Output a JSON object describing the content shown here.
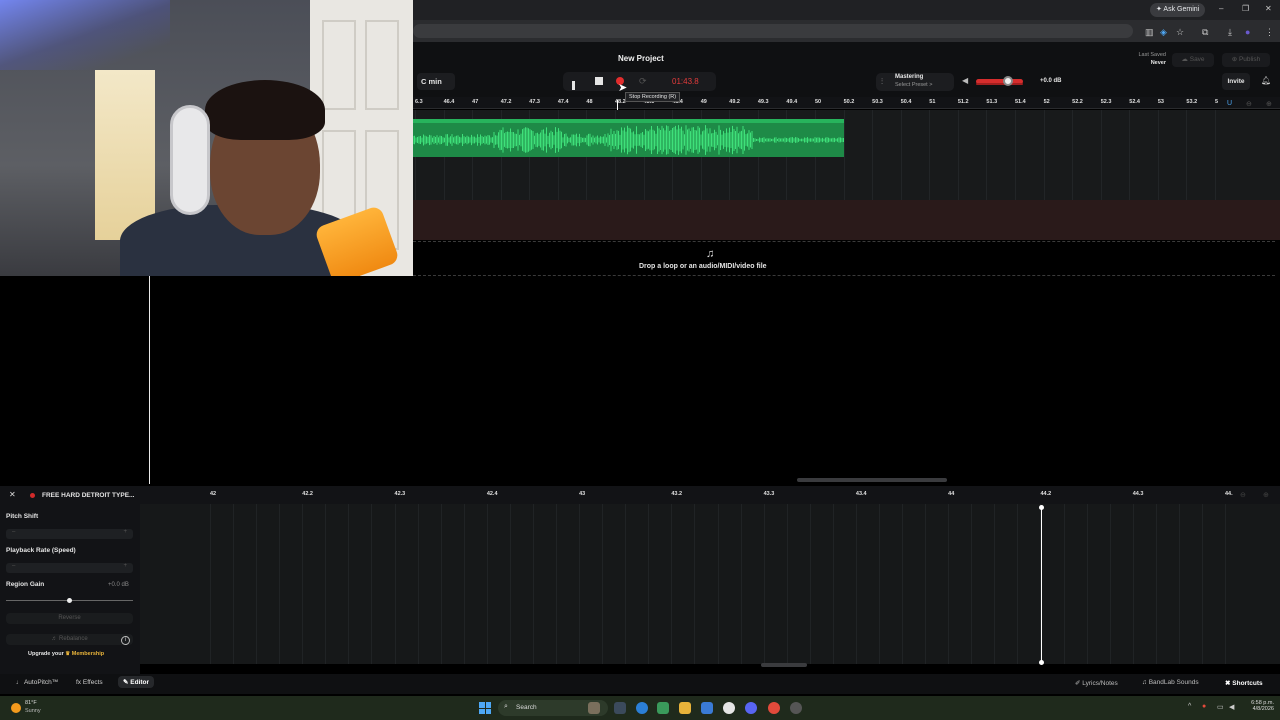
{
  "browser": {
    "ask_gemini": "✦ Ask Gemini",
    "window_controls": [
      "–",
      "❐",
      "✕"
    ]
  },
  "header": {
    "project_title": "New Project",
    "key": "C min",
    "time": "01:43.8",
    "tooltip": "Stop Recording (R)",
    "mastering_label": "Mastering",
    "mastering_preset": "Select Preset >",
    "volume_db": "+0.0 dB",
    "volume_level": 0.7,
    "last_saved_label": "Last Saved",
    "last_saved_value": "Never",
    "save_label": "Save",
    "publish_label": "Publish",
    "invite_label": "Invite"
  },
  "ruler_top": [
    "6.3",
    "46.4",
    "47",
    "47.2",
    "47.3",
    "47.4",
    "48",
    "48.2",
    "48.3",
    "48.4",
    "49",
    "49.2",
    "49.3",
    "49.4",
    "50",
    "50.2",
    "50.3",
    "50.4",
    "51",
    "51.2",
    "51.3",
    "51.4",
    "52",
    "52.2",
    "52.3",
    "52.4",
    "53",
    "53.2",
    "5"
  ],
  "drop_zone": {
    "text": "Drop a loop or an audio/MIDI/video file"
  },
  "editor": {
    "region_name": "FREE HARD DETROIT TYPE...",
    "ruler": [
      "42",
      "42.2",
      "42.3",
      "42.4",
      "43",
      "43.2",
      "43.3",
      "43.4",
      "44",
      "44.2",
      "44.3",
      "44."
    ],
    "pitch_shift_label": "Pitch Shift",
    "playback_rate_label": "Playback Rate (Speed)",
    "region_gain_label": "Region Gain",
    "region_gain_value": "+0.0 dB",
    "region_gain_level": 0.5,
    "reverse_label": "Reverse",
    "rebalance_label": "Rebalance",
    "upgrade_prefix": "Upgrade your",
    "upgrade_link": "Membership"
  },
  "toolbar": {
    "autopitch": "AutoPitch™",
    "effects": "Effects",
    "editor": "Editor",
    "lyrics": "Lyrics/Notes",
    "sounds": "BandLab Sounds",
    "shortcuts": "Shortcuts"
  },
  "taskbar": {
    "temp": "81°F",
    "condition": "Sunny",
    "search_placeholder": "Search",
    "time": "6:58 p.m.",
    "date": "4/8/2026"
  },
  "colors": {
    "region_green": "#1e8a47",
    "record_red": "#e22d2d",
    "accent_gold": "#e8b33a"
  }
}
